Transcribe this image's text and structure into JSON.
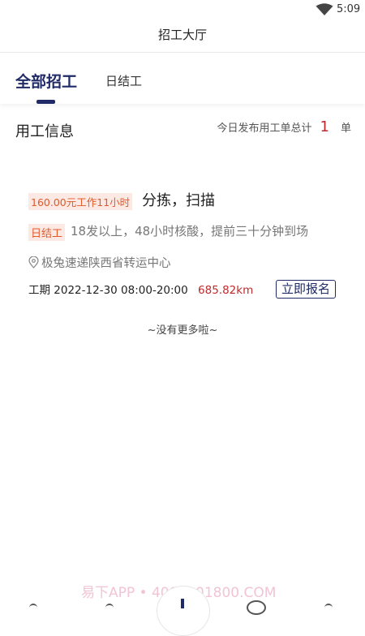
{
  "status_bar": {
    "time": "5:09",
    "wifi_icon": "wifi-icon"
  },
  "header": {
    "title": "招工大厅"
  },
  "tabs": [
    {
      "label": "全部招工",
      "active": true
    },
    {
      "label": "日结工",
      "active": false
    }
  ],
  "section": {
    "title": "用工信息",
    "summary_prefix": "今日发布用工单总计",
    "summary_count": "1",
    "summary_unit": "单"
  },
  "job": {
    "salary_tag": "160.00元工作11小时",
    "name": "分拣，扫描",
    "type_tag": "日结工",
    "requirements": "18发以上，48小时核酸，提前三十分钟到场",
    "location_icon": "location-pin-icon",
    "location": "极兔速递陕西省转运中心",
    "period_label": "工期 2022-12-30   08:00-20:00",
    "distance": "685.82km",
    "apply_label": "立即报名"
  },
  "list_footer": "~没有更多啦~",
  "watermark": "易下APP • 4008001800.COM",
  "colors": {
    "primary": "#1f2a67",
    "accent_red": "#c0282b",
    "tag_bg": "#fde9e4",
    "tag_text": "#e05a2a"
  }
}
